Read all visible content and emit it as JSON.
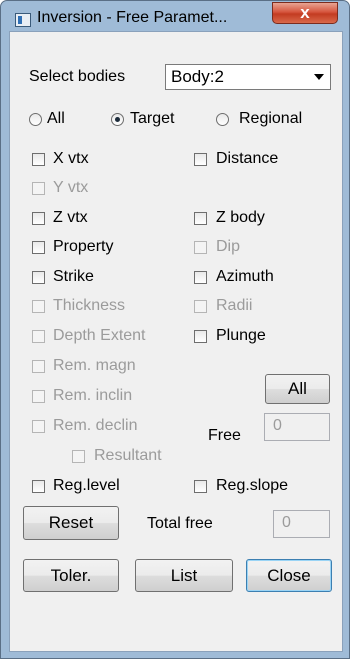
{
  "window": {
    "title": "Inversion - Free Paramet...",
    "close_glyph": "x"
  },
  "select_bodies": {
    "label": "Select bodies",
    "value": "Body:2"
  },
  "mode": {
    "all": "All",
    "target": "Target",
    "regional": "Regional",
    "selected": "Target"
  },
  "params": {
    "x_vtx": "X vtx",
    "distance": "Distance",
    "y_vtx": "Y vtx",
    "z_vtx": "Z vtx",
    "z_body": "Z body",
    "property": "Property",
    "dip": "Dip",
    "strike": "Strike",
    "azimuth": "Azimuth",
    "thickness": "Thickness",
    "radii": "Radii",
    "depth_extent": "Depth Extent",
    "plunge": "Plunge",
    "rem_magn": "Rem. magn",
    "rem_inclin": "Rem. inclin",
    "rem_declin": "Rem. declin",
    "resultant": "Resultant",
    "reg_level": "Reg.level",
    "reg_slope": "Reg.slope"
  },
  "all_button": "All",
  "free": {
    "label": "Free",
    "value": "0"
  },
  "reset_button": "Reset",
  "total_free": {
    "label": "Total free",
    "value": "0"
  },
  "buttons": {
    "toler": "Toler.",
    "list": "List",
    "close": "Close"
  },
  "colors": {
    "frame": "#9fbbd7",
    "client": "#f0f0f0",
    "close_red": "#c33b21",
    "disabled_text": "#9b9b9b"
  }
}
